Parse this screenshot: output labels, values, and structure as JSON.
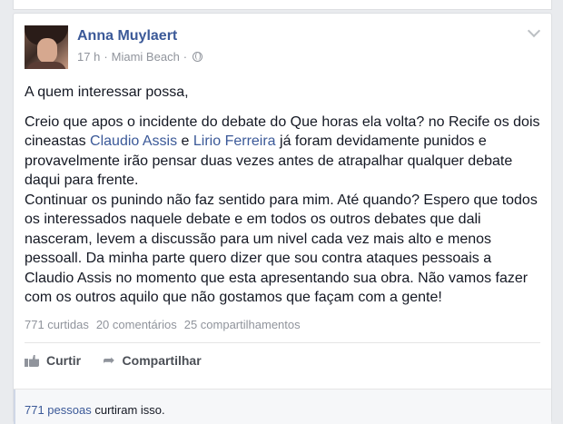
{
  "post": {
    "author": "Anna Muylaert",
    "time": "17 h",
    "location": "Miami Beach",
    "separator": "·",
    "greeting": "A quem interessar possa,",
    "paragraph1_a": "Creio que apos o incidente do debate do Que horas ela volta? no Recife os dois cineastas ",
    "link1": "Claudio Assis",
    "paragraph1_b": " e ",
    "link2": "Lirio Ferreira",
    "paragraph1_c": " já foram devidamente punidos e provavelmente irão pensar duas vezes antes de atrapalhar qualquer debate daqui para frente.",
    "paragraph2": "Continuar os punindo não faz sentido para mim. Até quando? Espero que todos os interessados naquele debate e em todos os outros debates que dali nasceram, levem a discussão para um nivel cada vez mais alto e menos pessoall. Da minha parte quero dizer que sou contra ataques pessoais a Claudio Assis no momento que esta apresentando sua obra. Não vamos fazer com os outros aquilo que não gostamos que façam com a gente!"
  },
  "stats": {
    "likes": "771 curtidas",
    "comments": "20 comentários",
    "shares": "25 compartilhamentos"
  },
  "actions": {
    "like_label": "Curtir",
    "share_label": "Compartilhar"
  },
  "likes_summary": {
    "people_link": "771 pessoas",
    "suffix": " curtiram isso."
  },
  "colors": {
    "link": "#3b5998",
    "muted": "#90949c",
    "text": "#141823"
  }
}
